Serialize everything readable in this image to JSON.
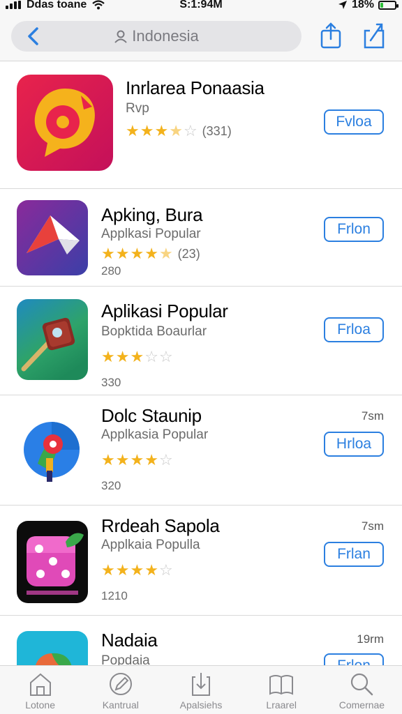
{
  "status_bar": {
    "carrier": "Ddas toane",
    "time": "S:1:94M",
    "battery": "18%",
    "battery_level": 0.18
  },
  "nav": {
    "search_text": "Indonesia"
  },
  "apps": [
    {
      "name": "Inrlarea Ponaasia",
      "subtitle": "Rvp",
      "rating": 3.5,
      "rating_count": "(331)",
      "count": "",
      "time": "",
      "button": "Fvloa"
    },
    {
      "name": "Apking, Bura",
      "subtitle": "Applkasi Popular",
      "rating": 4.5,
      "rating_count": "(23)",
      "count": "280",
      "time": "",
      "button": "Frlon"
    },
    {
      "name": "Aplikasi Popular",
      "subtitle": "Bopktida Boaurlar",
      "rating": 3,
      "rating_count": "",
      "count": "330",
      "time": "",
      "button": "Frloa"
    },
    {
      "name": "Dolc Staunip",
      "subtitle": "Applkasia Popular",
      "rating": 4,
      "rating_count": "",
      "count": "320",
      "time": "7sm",
      "button": "Hrloa"
    },
    {
      "name": "Rrdeah Sapola",
      "subtitle": "Applkaia Populla",
      "rating": 4,
      "rating_count": "",
      "count": "1210",
      "time": "7sm",
      "button": "Frlan"
    },
    {
      "name": "Nadaia",
      "subtitle": "Popdaia",
      "rating": 0,
      "rating_count": "",
      "count": "",
      "time": "19rm",
      "button": "Frlon"
    }
  ],
  "tabs": [
    {
      "label": "Lotone",
      "icon": "home-icon"
    },
    {
      "label": "Kantrual",
      "icon": "pen-icon"
    },
    {
      "label": "Apalsiehs",
      "icon": "download-icon"
    },
    {
      "label": "Lraarel",
      "icon": "book-icon"
    },
    {
      "label": "Comernae",
      "icon": "search-icon"
    }
  ],
  "colors": {
    "accent": "#2b7fe0",
    "star": "#f3b21c"
  }
}
